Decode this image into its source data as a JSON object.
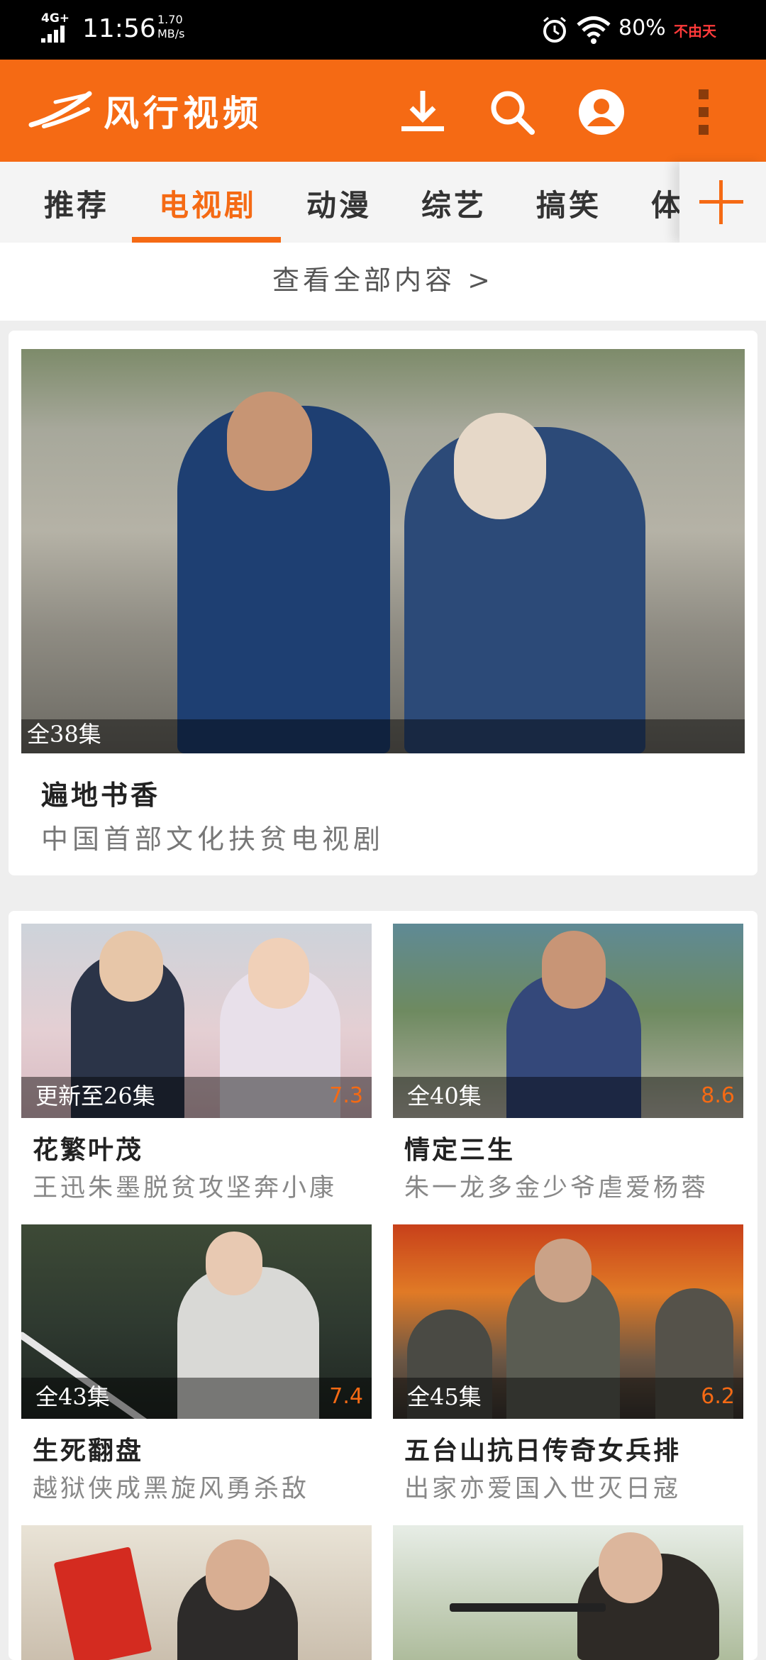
{
  "status_bar": {
    "network": "4G+",
    "time": "11:56",
    "speed_value": "1.70",
    "speed_unit": "MB/s",
    "battery": "80%",
    "carrier_badge": "不由天"
  },
  "app_bar": {
    "title": "风行视频",
    "icons": [
      "download-icon",
      "search-icon",
      "account-icon",
      "more-icon"
    ]
  },
  "tabs": {
    "items": [
      "推荐",
      "电视剧",
      "动漫",
      "综艺",
      "搞笑",
      "体"
    ],
    "active_index": 1,
    "add_icon": "plus-icon"
  },
  "view_all": "查看全部内容 >",
  "featured": {
    "episode": "全38集",
    "title": "遍地书香",
    "subtitle": "中国首部文化扶贫电视剧"
  },
  "items": [
    {
      "episode": "更新至26集",
      "score": "7.3",
      "title": "花繁叶茂",
      "subtitle": "王迅朱墨脱贫攻坚奔小康"
    },
    {
      "episode": "全40集",
      "score": "8.6",
      "title": "情定三生",
      "subtitle": "朱一龙多金少爷虐爱杨蓉"
    },
    {
      "episode": "全43集",
      "score": "7.4",
      "title": "生死翻盘",
      "subtitle": "越狱侠成黑旋风勇杀敌"
    },
    {
      "episode": "全45集",
      "score": "6.2",
      "title": "五台山抗日传奇女兵排",
      "subtitle": "出家亦爱国入世灭日寇"
    }
  ],
  "colors": {
    "brand": "#f56a14",
    "status_bar": "#000000",
    "score": "#f56a14"
  }
}
